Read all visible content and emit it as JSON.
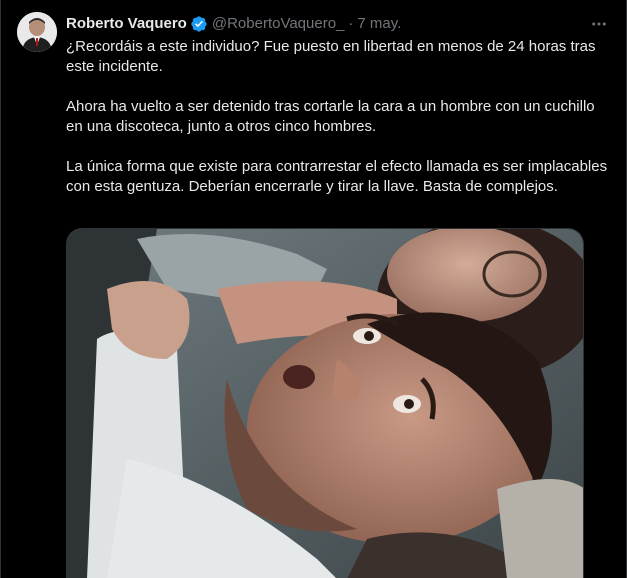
{
  "tweet": {
    "author": {
      "name": "Roberto Vaquero",
      "handle": "@RobertoVaquero_",
      "verified": true,
      "verified_icon": "verified-badge-icon",
      "avatar_icon": "avatar"
    },
    "separator": "·",
    "date": "7 may.",
    "more_icon": "more-options-icon",
    "paragraphs": [
      "¿Recordáis a este individuo? Fue puesto en libertad en menos de 24 horas tras este incidente.",
      "Ahora ha vuelto a ser detenido tras cortarle la cara a un hombre con un cuchillo en una discoteca, junto a otros cinco hombres.",
      "La única forma que existe para contrarrestar el efecto llamada es ser implacables con esta gentuza. Deberían encerrarle y tirar la llave. Basta de complejos."
    ]
  },
  "colors": {
    "background": "#000000",
    "text": "#e7e9ea",
    "secondary_text": "#71767b",
    "verified": "#1d9bf0",
    "border": "#2f3336"
  }
}
